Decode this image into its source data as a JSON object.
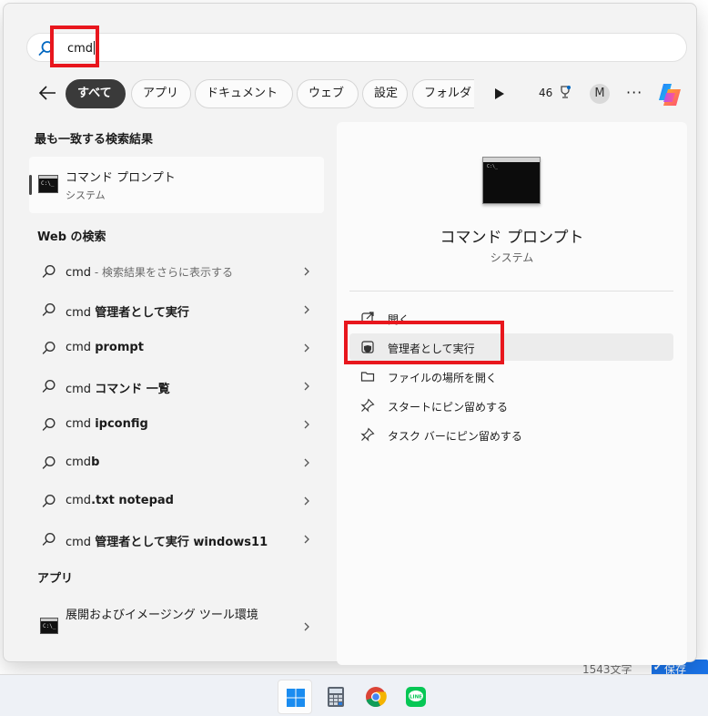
{
  "background": {
    "status_text": "1543文字",
    "save_label": "保存"
  },
  "search": {
    "query": "cmd"
  },
  "filters": {
    "chips": [
      "すべて",
      "アプリ",
      "ドキュメント",
      "ウェブ",
      "設定",
      "フォルダ"
    ],
    "points": "46",
    "avatar": "M",
    "more": "···"
  },
  "best_match": {
    "heading": "最も一致する検索結果",
    "title": "コマンド プロンプト",
    "subtitle": "システム",
    "icon_text": "C:\\_"
  },
  "web": {
    "heading": "Web の検索",
    "items": [
      {
        "prefix": "cmd",
        "bold": "",
        "muted": " - 検索結果をさらに表示する"
      },
      {
        "prefix": "cmd ",
        "bold": "管理者として実行",
        "muted": ""
      },
      {
        "prefix": "cmd ",
        "bold": "prompt",
        "muted": ""
      },
      {
        "prefix": "cmd ",
        "bold": "コマンド 一覧",
        "muted": ""
      },
      {
        "prefix": "cmd ",
        "bold": "ipconfig",
        "muted": ""
      },
      {
        "prefix": "cmd",
        "bold": "b",
        "muted": ""
      },
      {
        "prefix": "cmd",
        "bold": ".txt notepad",
        "muted": ""
      },
      {
        "prefix": "cmd ",
        "bold": "管理者として実行 windows11",
        "muted": ""
      }
    ]
  },
  "apps": {
    "heading": "アプリ",
    "item_label": "展開およびイメージング ツール環境"
  },
  "preview": {
    "title": "コマンド プロンプト",
    "subtitle": "システム",
    "actions": [
      {
        "label": "開く",
        "icon": "open-external-icon"
      },
      {
        "label": "管理者として実行",
        "icon": "shield-icon"
      },
      {
        "label": "ファイルの場所を開く",
        "icon": "folder-icon"
      },
      {
        "label": "スタートにピン留めする",
        "icon": "pin-icon"
      },
      {
        "label": "タスク バーにピン留めする",
        "icon": "pin-icon"
      }
    ]
  },
  "taskbar": {
    "apps": [
      "start-icon",
      "calculator-icon",
      "chrome-icon",
      "line-icon"
    ]
  },
  "colors": {
    "highlight": "#e8161d",
    "accent_blue": "#0067c0"
  }
}
